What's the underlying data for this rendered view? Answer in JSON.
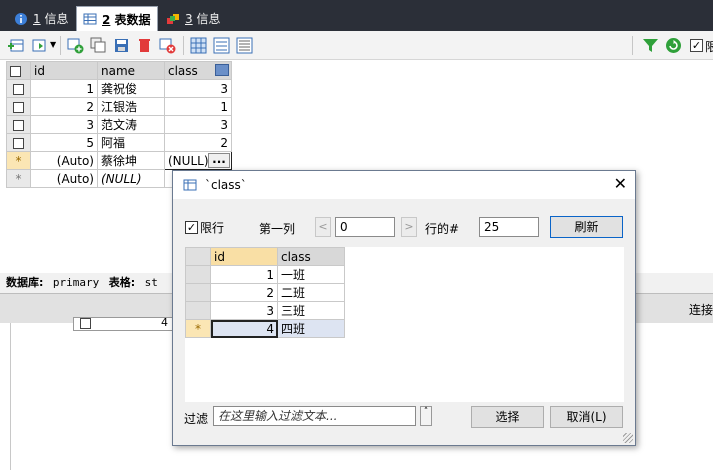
{
  "tabs": [
    {
      "num": "1",
      "label": "信息",
      "active": false
    },
    {
      "num": "2",
      "label": "表数据",
      "active": true
    },
    {
      "num": "3",
      "label": "信息",
      "active": false
    }
  ],
  "toolbar": {
    "limit_label": "限"
  },
  "main_grid": {
    "columns": [
      "id",
      "name",
      "class"
    ],
    "rows": [
      {
        "id": "1",
        "name": "龚祝俊",
        "class": "3"
      },
      {
        "id": "2",
        "name": "江银浩",
        "class": "1"
      },
      {
        "id": "3",
        "name": "范文涛",
        "class": "3"
      },
      {
        "id": "5",
        "name": "阿福",
        "class": "2"
      }
    ],
    "new_row": {
      "marker": "*",
      "id": "(Auto)",
      "name": "蔡徐坤",
      "class": "(NULL)",
      "button": "..."
    },
    "blank_row": {
      "marker": "*",
      "id": "(Auto)",
      "name": "(NULL)"
    }
  },
  "status": {
    "db_label": "数据库:",
    "db_value": "primary",
    "table_label": "表格:",
    "table_value": "st"
  },
  "lower": {
    "connect_label": "连接",
    "partial_value": "4"
  },
  "dialog": {
    "title": "`class`",
    "limit_label": "限行",
    "limit_checked": true,
    "first_row_label": "第一列",
    "first_row_value": "0",
    "rows_label": "行的#",
    "rows_value": "25",
    "refresh_label": "刷新",
    "grid": {
      "columns": [
        "id",
        "class"
      ],
      "rows": [
        {
          "marker": "",
          "id": "1",
          "class": "一班"
        },
        {
          "marker": "",
          "id": "2",
          "class": "二班"
        },
        {
          "marker": "",
          "id": "3",
          "class": "三班"
        },
        {
          "marker": "*",
          "id": "4",
          "class": "四班"
        }
      ]
    },
    "filter_label": "过滤",
    "filter_placeholder": "在这里输入过滤文本...",
    "select_label": "选择",
    "cancel_label": "取消(L)"
  },
  "colors": {
    "tabstrip": "#2b2f38",
    "accent_blue": "#0a64c8",
    "highlight_header": "#f9dfa5"
  }
}
